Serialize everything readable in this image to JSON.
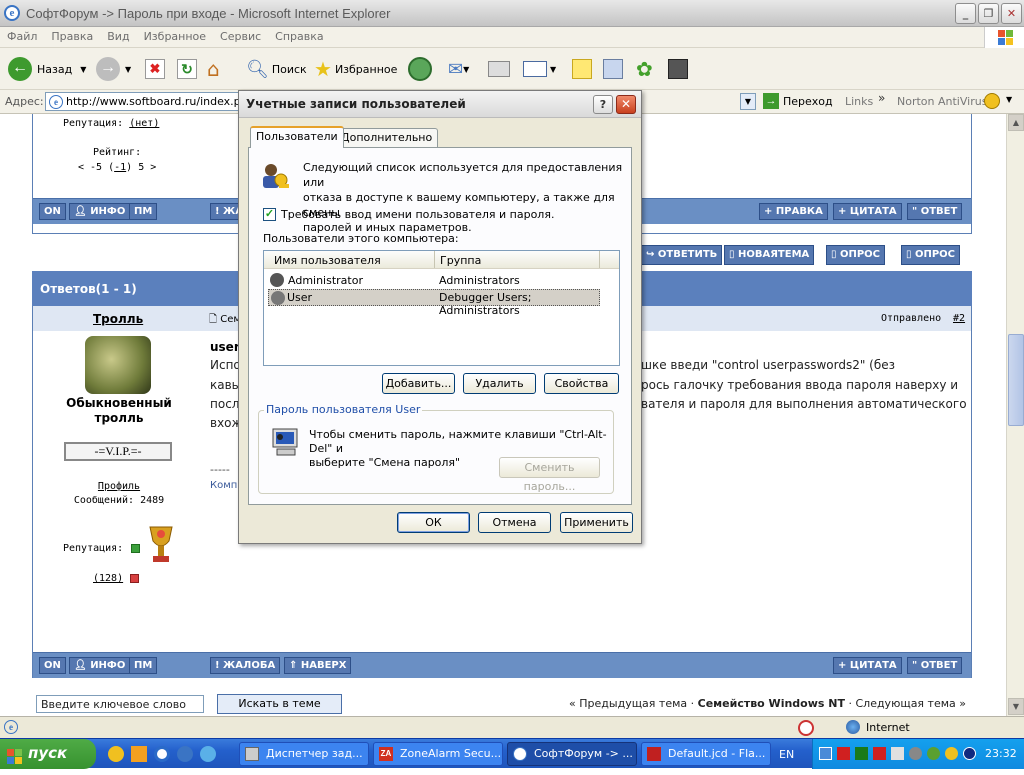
{
  "window": {
    "title": "СофтФорум -> Пароль при входе - Microsoft Internet Explorer"
  },
  "menu": [
    "Файл",
    "Правка",
    "Вид",
    "Избранное",
    "Сервис",
    "Справка"
  ],
  "toolbar": {
    "back": "Назад",
    "search": "Поиск",
    "favorites": "Избранное"
  },
  "address": {
    "label": "Адрес:",
    "url": "http://www.softboard.ru/index.php",
    "go": "Переход",
    "links": "Links",
    "norton": "Norton AntiVirus"
  },
  "post1": {
    "reputation_label": "Репутация:",
    "reputation_value": "(нет)",
    "rating_label": "Рейтинг:",
    "rating_minus": "< -5 (",
    "rating_value": "-1",
    "rating_plus": ") 5 >",
    "buttons": [
      "ON",
      "ИНФО",
      "ПМ",
      "ЖА"
    ],
    "right_buttons": [
      "ПРАВКА",
      "ЦИТАТА",
      "ОТВЕТ"
    ]
  },
  "actions": [
    "ОТВЕТИТЬ",
    "НОВАЯТЕМА",
    "ОПРОС",
    "ОПРОС"
  ],
  "replies_header": "Ответов(1 - 1)",
  "post2": {
    "author": "Тролль",
    "rank1": "Обыкновенный",
    "rank2": "тролль",
    "badge": "-=V.I.P.=-",
    "profile": "Профиль",
    "messages": "Сообщений: 2489",
    "reputation_label": "Репутация:",
    "reputation_count": "(128)",
    "header_left": "Сем",
    "sent_label": "Отправлено",
    "sent_link": "#2",
    "body_start": "user",
    "line1a": "Испо",
    "line1b": "шке введи \"control userpasswords2\" (без",
    "line2a": "кавы",
    "line2b": "рось галочку требования ввода пароля наверху и",
    "line3a": "посл",
    "line3b": "вателя и пароля для выполнения автоматического",
    "line4a": "вхож",
    "sig_dash": "-----",
    "sig_text": "Комп",
    "buttons": [
      "ON",
      "ИНФО",
      "ПМ",
      "ЖАЛОБА",
      "НАВЕРХ"
    ],
    "right_buttons": [
      "ЦИТАТА",
      "ОТВЕТ"
    ]
  },
  "search": {
    "placeholder": "Введите ключевое слово",
    "button": "Искать в теме",
    "nav_prev": "« Предыдущая тема ·",
    "nav_forum": "Семейство Windows NT",
    "nav_next": "· Следующая тема »"
  },
  "status": {
    "zone": "Internet"
  },
  "taskbar": {
    "start": "пуск",
    "tasks": [
      "Диспетчер зад...",
      "ZoneAlarm Secu...",
      "СофтФорум -> ...",
      "Default.jcd - Fla..."
    ],
    "lang": "EN",
    "clock": "23:32"
  },
  "dialog": {
    "title": "Учетные записи пользователей",
    "tabs": [
      "Пользователи",
      "Дополнительно"
    ],
    "intro1": "Следующий список используется для предоставления или",
    "intro2": "отказа в доступе к вашему компьютеру, а также для смены",
    "intro3": "паролей и иных параметров.",
    "require_login": "Требовать ввод имени пользователя и пароля.",
    "users_label": "Пользователи этого компьютера:",
    "col_user": "Имя пользователя",
    "col_group": "Группа",
    "rows": [
      {
        "user": "Administrator",
        "group": "Administrators"
      },
      {
        "user": "User",
        "group": "Debugger Users; Administrators"
      }
    ],
    "add": "Добавить...",
    "remove": "Удалить",
    "props": "Свойства",
    "pw_group": "Пароль пользователя User",
    "pw_text1": "Чтобы сменить пароль, нажмите клавиши \"Ctrl-Alt-Del\" и",
    "pw_text2": "выберите \"Смена пароля\"",
    "change_pw": "Сменить пароль...",
    "ok": "ОК",
    "cancel": "Отмена",
    "apply": "Применить"
  }
}
